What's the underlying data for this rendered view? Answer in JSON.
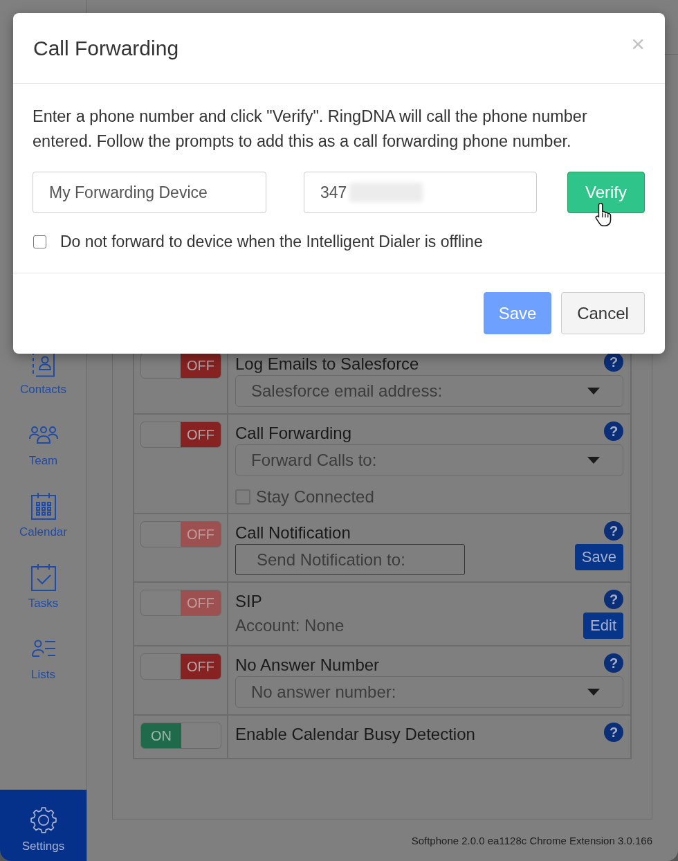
{
  "modal": {
    "title": "Call Forwarding",
    "close": "×",
    "message": "Enter a phone number and click \"Verify\". RingDNA will call the phone number entered. Follow the prompts to add this as a call forwarding phone number.",
    "name_field": {
      "value": "My Forwarding Device"
    },
    "phone_field": {
      "value": "347",
      "redacted": true
    },
    "verify_button": {
      "label": "Verify",
      "hovered": true
    },
    "offline_checkbox": {
      "label": "Do not forward to device when the Intelligent Dialer is offline",
      "checked": false
    },
    "buttons": [
      {
        "label": "Save",
        "kind": "primary",
        "disabled": true
      },
      {
        "label": "Cancel",
        "kind": "default",
        "disabled": false
      }
    ]
  },
  "sidebar": {
    "items": [
      {
        "label": "Contacts",
        "selected": false
      },
      {
        "label": "Team",
        "selected": false
      },
      {
        "label": "Calendar",
        "selected": false
      },
      {
        "label": "Tasks",
        "selected": false
      },
      {
        "label": "Lists",
        "selected": false
      },
      {
        "label": "Settings",
        "selected": true
      }
    ]
  },
  "settings": {
    "rows": [
      {
        "title": "Log Emails to Salesforce",
        "help": "?",
        "toggle": {
          "label": "OFF",
          "on": false,
          "disabled": false
        },
        "controls": [
          {
            "kind": "select",
            "placeholder": "Salesforce email address:"
          }
        ]
      },
      {
        "title": "Call Forwarding",
        "help": "?",
        "toggle": {
          "label": "OFF",
          "on": false,
          "disabled": false
        },
        "controls": [
          {
            "kind": "select",
            "placeholder": "Forward Calls to:"
          },
          {
            "kind": "checkbox",
            "label": "Stay Connected",
            "checked": false
          }
        ]
      },
      {
        "title": "Call Notification",
        "help": "?",
        "toggle": {
          "label": "OFF",
          "on": false,
          "disabled": true
        },
        "controls": [
          {
            "kind": "input",
            "placeholder": "Send Notification to:"
          },
          {
            "kind": "button",
            "label": "Save"
          }
        ]
      },
      {
        "title": "SIP",
        "help": "?",
        "toggle": {
          "label": "OFF",
          "on": false,
          "disabled": true
        },
        "controls": [
          {
            "kind": "text",
            "text": "Account: None"
          },
          {
            "kind": "button",
            "label": "Edit"
          }
        ]
      },
      {
        "title": "No Answer Number",
        "help": "?",
        "toggle": {
          "label": "OFF",
          "on": false,
          "disabled": false
        },
        "controls": [
          {
            "kind": "select",
            "placeholder": "No answer number:"
          }
        ]
      },
      {
        "title": "Enable Calendar Busy Detection",
        "help": "?",
        "toggle": {
          "label": "ON",
          "on": true,
          "disabled": false
        }
      }
    ]
  },
  "footer": {
    "version": "Softphone 2.0.0 ea1128c Chrome Extension 3.0.166"
  }
}
